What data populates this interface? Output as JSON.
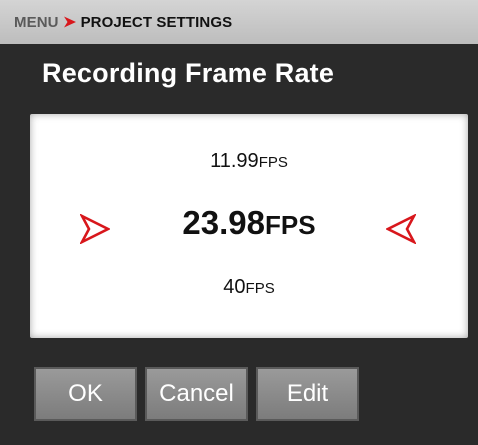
{
  "breadcrumb": {
    "menu": "MENU",
    "current": "PROJECT SETTINGS"
  },
  "title": "Recording Frame Rate",
  "selector": {
    "previous": {
      "value": "11.99",
      "unit": "FPS"
    },
    "current": {
      "value": "23.98",
      "unit": "FPS"
    },
    "next": {
      "value": "40",
      "unit": "FPS"
    }
  },
  "buttons": {
    "ok": "OK",
    "cancel": "Cancel",
    "edit": "Edit"
  },
  "colors": {
    "accent": "#d8171c",
    "breadcrumb_bg": "#c9c9c9",
    "background": "#2a2a2a",
    "button_bg": "#8a8a8a"
  },
  "icons": {
    "breadcrumb_separator": "chevron-right-icon",
    "left_arrow": "arrow-right-pointing-icon",
    "right_arrow": "arrow-left-pointing-icon"
  }
}
